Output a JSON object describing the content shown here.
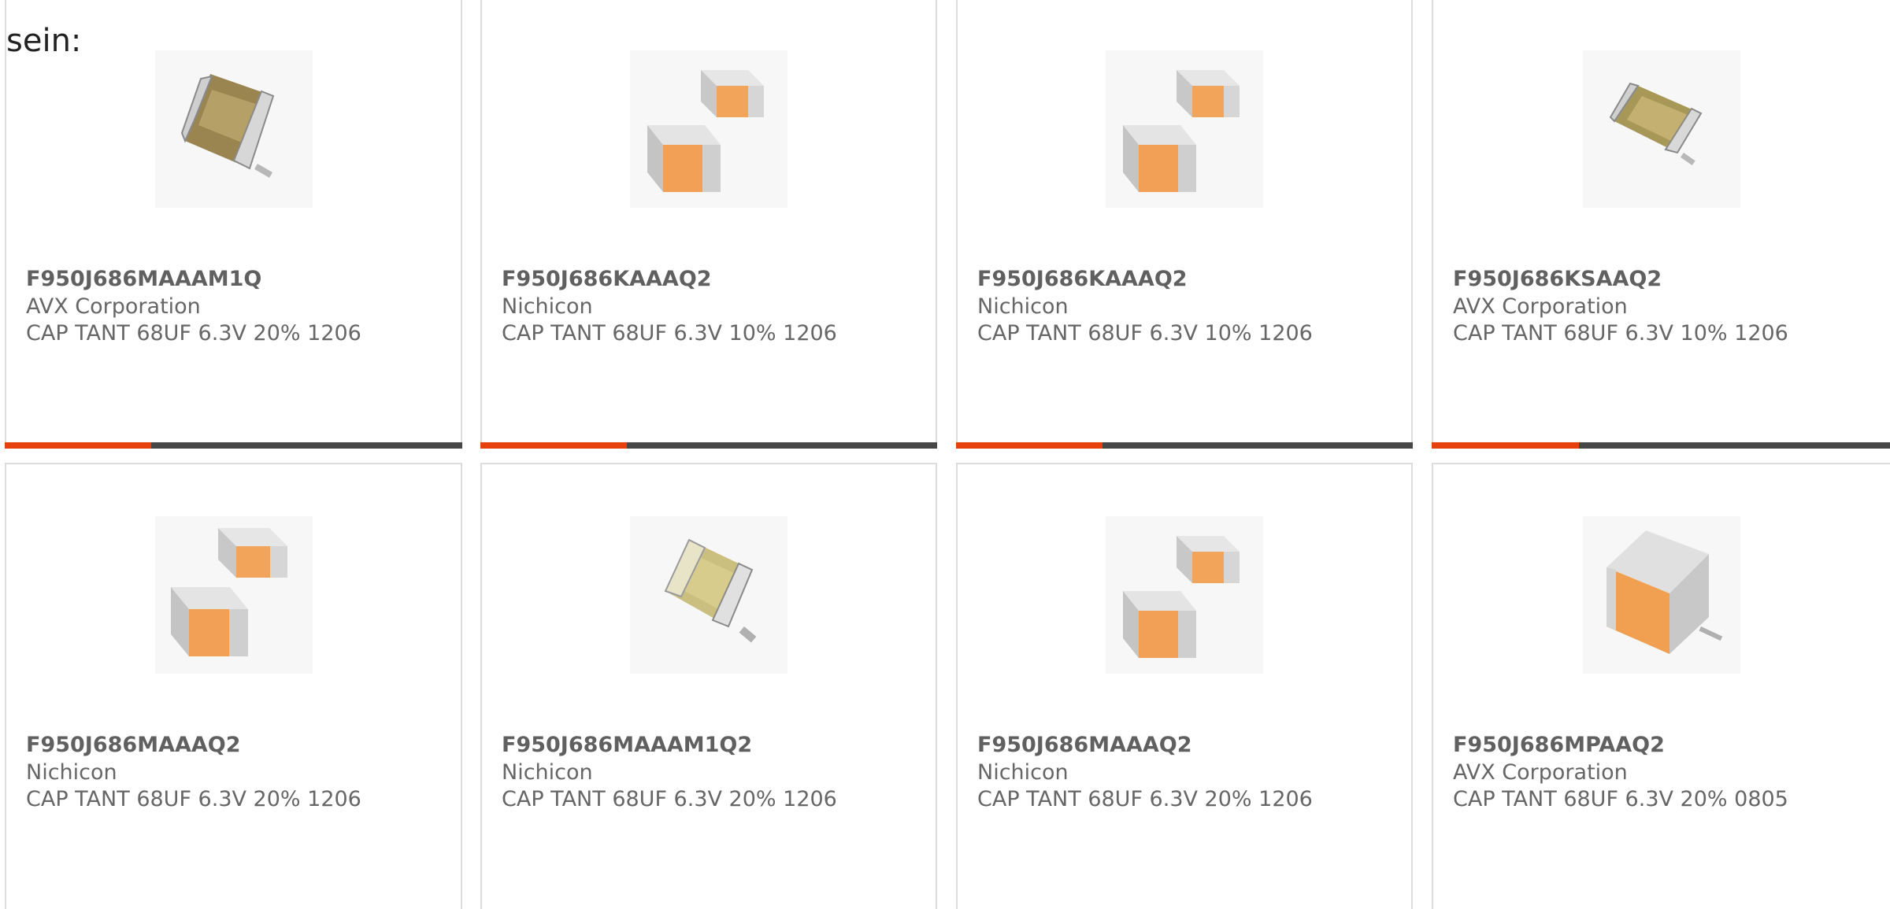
{
  "intro_text": "sein:",
  "colors": {
    "accent": "#e8400c",
    "bar_dark": "#474747",
    "card_border": "#dcdcdc",
    "text_bold": "#606060",
    "text_muted": "#666666",
    "body_orange": "#f0a050",
    "body_tantalum": "#b0a060",
    "cap_silver": "#d0d0d0"
  },
  "products": [
    {
      "part_number": "F950J686MAAAM1Q",
      "manufacturer": "AVX Corporation",
      "description": "CAP TANT 68UF 6.3V 20% 1206",
      "image_icon": "tantalum-capacitor-silver-icon"
    },
    {
      "part_number": "F950J686KAAAQ2",
      "manufacturer": "Nichicon",
      "description": "CAP TANT 68UF 6.3V 10% 1206",
      "image_icon": "chip-capacitor-pair-icon"
    },
    {
      "part_number": "F950J686KAAAQ2",
      "manufacturer": "Nichicon",
      "description": "CAP TANT 68UF 6.3V 10% 1206",
      "image_icon": "chip-capacitor-pair-icon"
    },
    {
      "part_number": "F950J686KSAAQ2",
      "manufacturer": "AVX Corporation",
      "description": "CAP TANT 68UF 6.3V 10% 1206",
      "image_icon": "tantalum-capacitor-silver-icon"
    },
    {
      "part_number": "F950J686MAAAQ2",
      "manufacturer": "Nichicon",
      "description": "CAP TANT 68UF 6.3V 20% 1206",
      "image_icon": "chip-capacitor-pair-icon"
    },
    {
      "part_number": "F950J686MAAAM1Q2",
      "manufacturer": "Nichicon",
      "description": "CAP TANT 68UF 6.3V 20% 1206",
      "image_icon": "tantalum-capacitor-clear-icon"
    },
    {
      "part_number": "F950J686MAAAQ2",
      "manufacturer": "Nichicon",
      "description": "CAP TANT 68UF 6.3V 20% 1206",
      "image_icon": "chip-capacitor-pair-icon"
    },
    {
      "part_number": "F950J686MPAAQ2",
      "manufacturer": "AVX Corporation",
      "description": "CAP TANT 68UF 6.3V 20% 0805",
      "image_icon": "tantalum-capacitor-orange-icon"
    }
  ]
}
